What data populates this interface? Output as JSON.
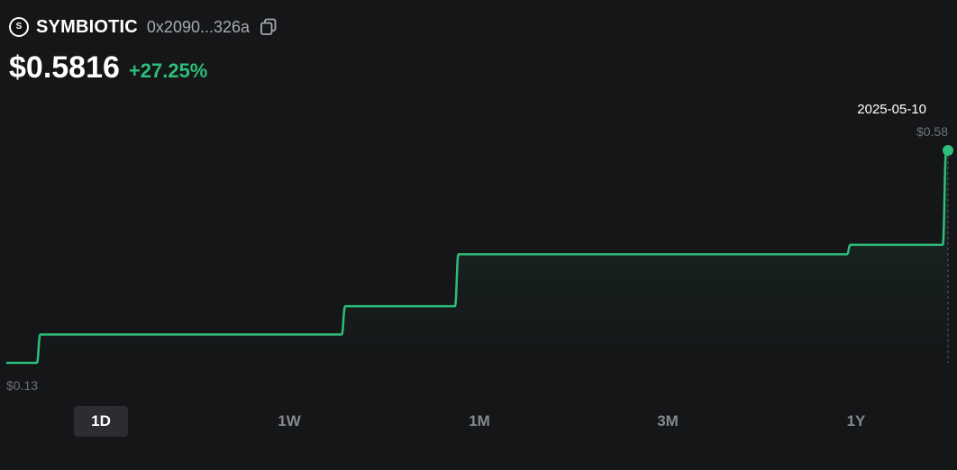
{
  "header": {
    "token_icon_letter": "S",
    "token_name": "SYMBIOTIC",
    "token_address": "0x2090...326a"
  },
  "price": {
    "value": "$0.5816",
    "change": "+27.25%"
  },
  "colors": {
    "background": "#151618",
    "line": "#2ebd7b",
    "muted_text": "#6d7076",
    "active_tab": "#2b2d31"
  },
  "chart_data": {
    "type": "line",
    "title": "",
    "xlabel": "",
    "ylabel": "",
    "min_label": "$0.13",
    "max_label": "$0.58",
    "hover_date": "2025-05-10",
    "ylim": [
      0.13,
      0.58
    ],
    "series": [
      {
        "values": [
          0.13,
          0.13,
          0.13,
          0.13,
          0.19,
          0.19,
          0.19,
          0.19,
          0.19,
          0.19,
          0.19,
          0.19,
          0.19,
          0.19,
          0.19,
          0.19,
          0.19,
          0.19,
          0.19,
          0.19,
          0.19,
          0.19,
          0.19,
          0.19,
          0.19,
          0.19,
          0.19,
          0.19,
          0.19,
          0.19,
          0.19,
          0.19,
          0.19,
          0.19,
          0.19,
          0.19,
          0.19,
          0.19,
          0.19,
          0.25,
          0.25,
          0.25,
          0.25,
          0.25,
          0.25,
          0.25,
          0.25,
          0.25,
          0.25,
          0.25,
          0.25,
          0.25,
          0.36,
          0.36,
          0.36,
          0.36,
          0.36,
          0.36,
          0.36,
          0.36,
          0.36,
          0.36,
          0.36,
          0.36,
          0.36,
          0.36,
          0.36,
          0.36,
          0.36,
          0.36,
          0.36,
          0.36,
          0.36,
          0.36,
          0.36,
          0.36,
          0.36,
          0.36,
          0.36,
          0.36,
          0.36,
          0.36,
          0.36,
          0.36,
          0.36,
          0.36,
          0.36,
          0.36,
          0.36,
          0.36,
          0.36,
          0.36,
          0.36,
          0.36,
          0.36,
          0.36,
          0.36,
          0.38,
          0.38,
          0.38,
          0.38,
          0.38,
          0.38,
          0.38,
          0.38,
          0.38,
          0.38,
          0.38,
          0.58
        ]
      }
    ]
  },
  "ranges": [
    {
      "label": "1D",
      "active": true
    },
    {
      "label": "1W",
      "active": false
    },
    {
      "label": "1M",
      "active": false
    },
    {
      "label": "3M",
      "active": false
    },
    {
      "label": "1Y",
      "active": false
    }
  ]
}
